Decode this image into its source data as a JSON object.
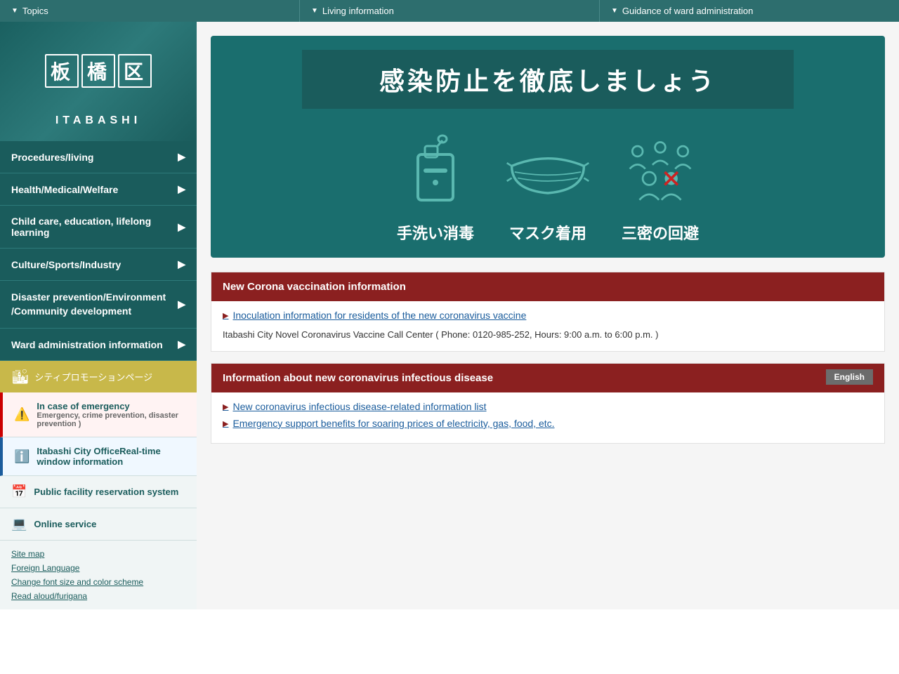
{
  "topNav": {
    "items": [
      {
        "id": "topics",
        "label": "Topics",
        "arrow": "▼"
      },
      {
        "id": "living",
        "label": "Living information",
        "arrow": "▼"
      },
      {
        "id": "ward",
        "label": "Guidance of ward administration",
        "arrow": "▼"
      }
    ]
  },
  "sidebar": {
    "logoKanji": [
      "板",
      "橋",
      "区"
    ],
    "logoText": "ITABASHI",
    "navItems": [
      {
        "id": "procedures",
        "label": "Procedures/living"
      },
      {
        "id": "health",
        "label": "Health/Medical/Welfare"
      },
      {
        "id": "childcare",
        "label": "Child care, education, lifelong learning"
      },
      {
        "id": "culture",
        "label": "Culture/Sports/Industry"
      },
      {
        "id": "disaster",
        "label": "Disaster prevention/Environment /Community development"
      },
      {
        "id": "ward-admin",
        "label": "Ward administration information"
      }
    ],
    "cityPromo": "シティプロモーションページ",
    "links": [
      {
        "id": "emergency",
        "label": "In case of emergency",
        "sublabel": "Emergency, crime prevention, disaster prevention )",
        "icon": "⚠"
      },
      {
        "id": "realtime",
        "label": "Itabashi City OfficeReal-time window information",
        "icon": "ℹ"
      }
    ],
    "bottomLinks": [
      {
        "id": "facility",
        "label": "Public facility reservation system",
        "icon": "📅"
      },
      {
        "id": "online",
        "label": "Online service",
        "icon": "💻"
      }
    ],
    "footerLinks": [
      "Site map",
      "Foreign Language",
      "Change font size and color scheme",
      "Read aloud/furigana"
    ]
  },
  "hero": {
    "title": "感染防止を徹底しましょう",
    "icons": [
      {
        "label": "手洗い消毒",
        "type": "soap"
      },
      {
        "label": "マスク着用",
        "type": "mask"
      },
      {
        "label": "三密の回避",
        "type": "crowd"
      }
    ]
  },
  "sections": [
    {
      "id": "vaccination",
      "title": "New Corona vaccination information",
      "links": [
        {
          "text": "Inoculation information for residents of the new coronavirus vaccine",
          "href": "#"
        }
      ],
      "body": "Itabashi City Novel Coronavirus Vaccine Call Center ( Phone: 0120-985-252, Hours: 9:00 a.m. to 6:00 p.m. )"
    },
    {
      "id": "infectious",
      "title": "Information about new coronavirus infectious disease",
      "englishBtn": "English",
      "links": [
        {
          "text": "New coronavirus infectious disease-related information list",
          "href": "#"
        },
        {
          "text": "Emergency support benefits for soaring prices of electricity, gas, food, etc.",
          "href": "#"
        }
      ]
    }
  ]
}
